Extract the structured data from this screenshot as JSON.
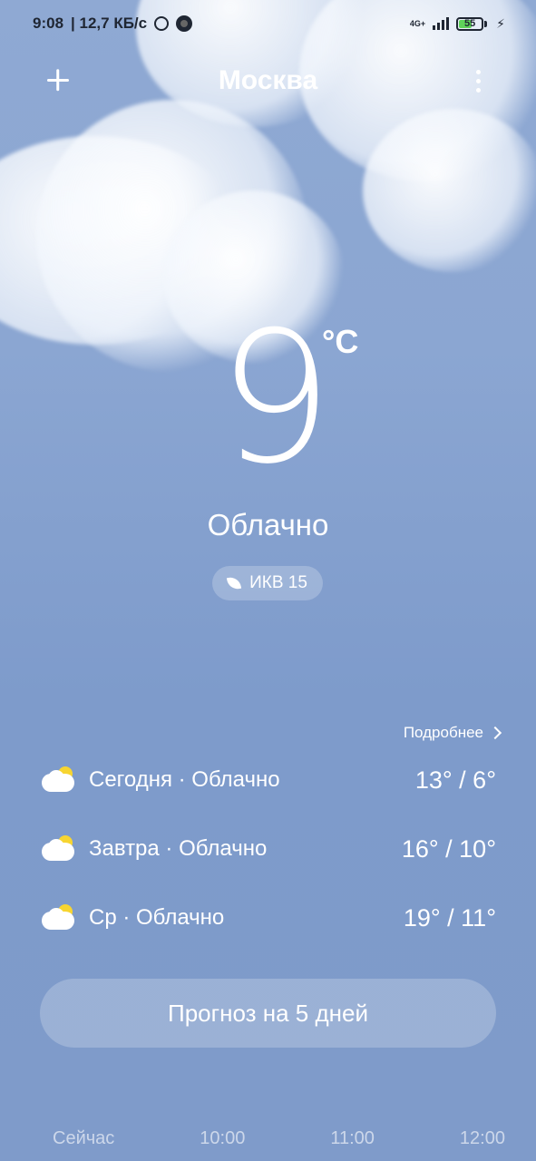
{
  "status_bar": {
    "time": "9:08",
    "speed": "| 12,7 КБ/с",
    "network": "4G+",
    "battery": "55"
  },
  "header": {
    "city": "Москва"
  },
  "current": {
    "temperature": "9",
    "unit": "°C",
    "condition": "Облачно",
    "aqi": "ИКВ 15"
  },
  "daily": {
    "more_label": "Подробнее",
    "rows": [
      {
        "label": "Сегодня · Облачно",
        "temps": "13° / 6°"
      },
      {
        "label": "Завтра · Облачно",
        "temps": "16° / 10°"
      },
      {
        "label": "Ср · Облачно",
        "temps": "19° / 11°"
      }
    ]
  },
  "forecast_button": "Прогноз на 5 дней",
  "hourly": [
    "Сейчас",
    "10:00",
    "11:00",
    "12:00"
  ]
}
